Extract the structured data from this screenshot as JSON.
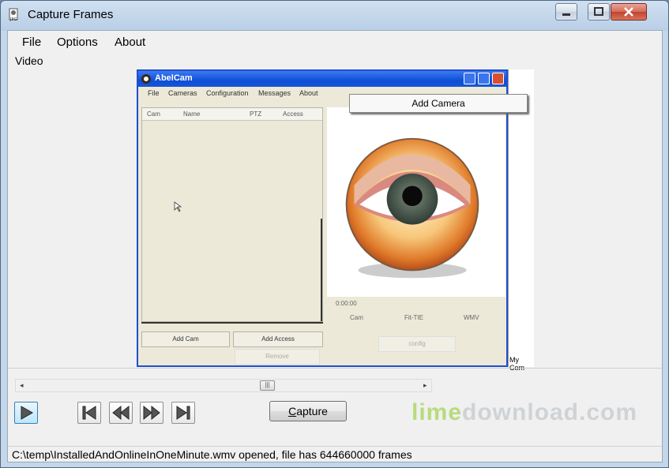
{
  "window": {
    "title": "Capture Frames"
  },
  "menu": {
    "file": "File",
    "options": "Options",
    "about": "About"
  },
  "video": {
    "label": "Video",
    "frame": {
      "app_title": "AbelCam",
      "menu": [
        "File",
        "Cameras",
        "Configuration",
        "Messages",
        "About"
      ],
      "columns": [
        "Cam",
        "Name",
        "PTZ",
        "Access"
      ],
      "buttons": {
        "add_cam": "Add Cam",
        "add_access": "Add Access",
        "remove": "Remove"
      },
      "tooltip": "Add Camera",
      "small_labels": [
        "0:00:00",
        "Cam",
        "Fit-TIE",
        "WMV",
        "config"
      ],
      "side_text": "My Com"
    }
  },
  "controls": {
    "scroll_thumb": "|||",
    "capture_label_first": "C",
    "capture_label_rest": "apture"
  },
  "status": {
    "text": "C:\\temp\\InstalledAndOnlineInOneMinute.wmv opened, file has 644660000 frames"
  },
  "watermark": {
    "part1": "lime",
    "part2": "download.com"
  },
  "icons": [
    "app-icon",
    "minimize-icon",
    "maximize-icon",
    "close-icon",
    "play-icon",
    "first-frame-icon",
    "rewind-icon",
    "fast-forward-icon",
    "last-frame-icon"
  ]
}
